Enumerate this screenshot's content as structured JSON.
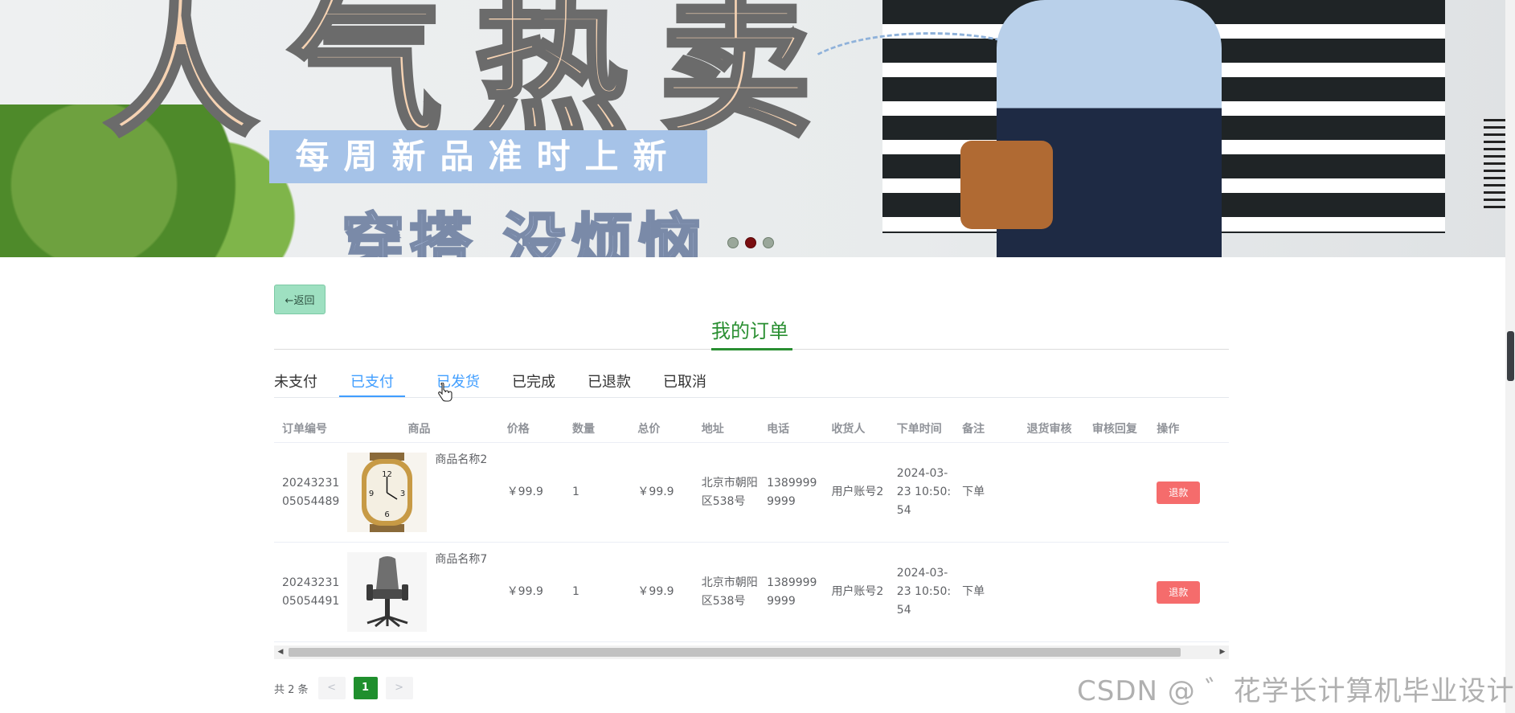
{
  "banner": {
    "headline": "人气热卖",
    "tag": "每周新品准时上新",
    "slogan": "穿搭 没烦恼",
    "dots": 3,
    "active_dot": 2
  },
  "back_label": "←返回",
  "page_title": "我的订单",
  "tabs": [
    {
      "label": "未支付"
    },
    {
      "label": "已支付"
    },
    {
      "label": "已发货"
    },
    {
      "label": "已完成"
    },
    {
      "label": "已退款"
    },
    {
      "label": "已取消"
    }
  ],
  "active_tab": "已支付",
  "table": {
    "headers": [
      "订单编号",
      "商品",
      "价格",
      "数量",
      "总价",
      "地址",
      "电话",
      "收货人",
      "下单时间",
      "备注",
      "退货审核",
      "审核回复",
      "操作"
    ],
    "rows": [
      {
        "order_no": "2024323105054489",
        "goods_name": "商品名称2",
        "goods_image": "watch-image",
        "price": "￥99.9",
        "qty": "1",
        "total": "￥99.9",
        "address": "北京市朝阳区538号",
        "phone": "13899999999",
        "receiver": "用户账号2",
        "time": "2024-03-23 10:50:54",
        "remark": "下单",
        "return_review": "",
        "review_reply": "",
        "action": "退款"
      },
      {
        "order_no": "2024323105054491",
        "goods_name": "商品名称7",
        "goods_image": "office-chair-image",
        "price": "￥99.9",
        "qty": "1",
        "total": "￥99.9",
        "address": "北京市朝阳区538号",
        "phone": "13899999999",
        "receiver": "用户账号2",
        "time": "2024-03-23 10:50:54",
        "remark": "下单",
        "return_review": "",
        "review_reply": "",
        "action": "退款"
      }
    ]
  },
  "pager": {
    "total": "共 2 条",
    "prev": "<",
    "page": "1",
    "next": ">"
  },
  "watermark": "CSDN @ ゛花学长计算机毕业设计",
  "colors": {
    "accent_green": "#2a8f32",
    "tab_blue": "#409eff",
    "refund_red": "#f56c6c"
  }
}
